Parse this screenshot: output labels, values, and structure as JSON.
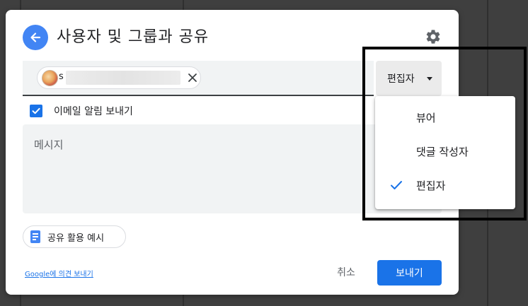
{
  "dialog": {
    "title": "사용자 및 그룹과 공유",
    "recipient": {
      "visible_initial": "s"
    },
    "role_select": {
      "label": "편집자"
    },
    "notify": {
      "label": "이메일 알림 보내기",
      "checked": true
    },
    "message": {
      "placeholder": "메시지"
    },
    "examples_button": {
      "label": "공유 활용 예시"
    },
    "footer": {
      "feedback_link": "Google에 의견 보내기",
      "cancel": "취소",
      "send": "보내기"
    }
  },
  "role_menu": {
    "items": [
      {
        "label": "뷰어",
        "selected": false
      },
      {
        "label": "댓글 작성자",
        "selected": false
      },
      {
        "label": "편집자",
        "selected": true
      }
    ]
  },
  "colors": {
    "accent": "#1a73e8",
    "back_button": "#4285f4",
    "backdrop": "#3f3f3f"
  },
  "icons": [
    "back-arrow-icon",
    "gear-icon",
    "close-icon",
    "dropdown-caret-icon",
    "checkbox-check-icon",
    "doc-icon",
    "checkmark-icon"
  ]
}
